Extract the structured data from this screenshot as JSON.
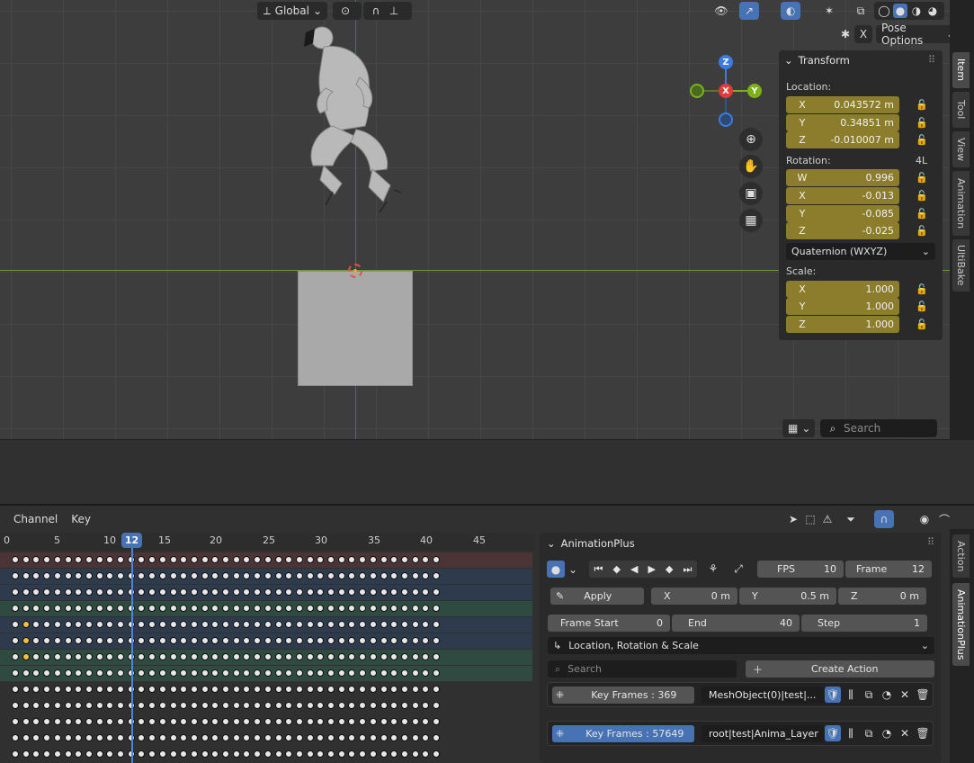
{
  "viewport_header": {
    "orientation_label": "Global",
    "pose_options_label": "Pose Options",
    "x_mirror_label": "X"
  },
  "gizmo": {
    "z": "Z",
    "x": "X",
    "y": "Y"
  },
  "transform_panel": {
    "title": "Transform",
    "location_label": "Location:",
    "location": [
      {
        "axis": "X",
        "value": "0.043572 m"
      },
      {
        "axis": "Y",
        "value": "0.34851 m"
      },
      {
        "axis": "Z",
        "value": "-0.010007 m"
      }
    ],
    "rotation_label": "Rotation:",
    "rotation_mode_badge": "4L",
    "rotation": [
      {
        "axis": "W",
        "value": "0.996"
      },
      {
        "axis": "X",
        "value": "-0.013"
      },
      {
        "axis": "Y",
        "value": "-0.085"
      },
      {
        "axis": "Z",
        "value": "-0.025"
      }
    ],
    "rotation_mode": "Quaternion (WXYZ)",
    "scale_label": "Scale:",
    "scale": [
      {
        "axis": "X",
        "value": "1.000"
      },
      {
        "axis": "Y",
        "value": "1.000"
      },
      {
        "axis": "Z",
        "value": "1.000"
      }
    ]
  },
  "viewport_tabs": [
    "Item",
    "Tool",
    "View",
    "Animation",
    "UltiBake"
  ],
  "viewport_search_placeholder": "Search",
  "dope_sheet": {
    "menus": [
      "Channel",
      "Key"
    ],
    "current_frame": "12",
    "ticks": [
      "0",
      "5",
      "10",
      "15",
      "20",
      "25",
      "30",
      "35",
      "40",
      "45"
    ]
  },
  "animation_plus": {
    "title": "AnimationPlus",
    "fps_label": "FPS",
    "fps_value": "10",
    "frame_label": "Frame",
    "frame_value": "12",
    "apply_label": "Apply",
    "x_label": "X",
    "x_value": "0 m",
    "y_label": "Y",
    "y_value": "0.5 m",
    "z_label": "Z",
    "z_value": "0 m",
    "frame_start_label": "Frame Start",
    "frame_start_value": "0",
    "end_label": "End",
    "end_value": "40",
    "step_label": "Step",
    "step_value": "1",
    "keying_set": "Location, Rotation & Scale",
    "search_placeholder": "Search",
    "create_action_label": "Create Action",
    "keyframe_rows": [
      {
        "label": "Key Frames : 369",
        "name": "MeshObject(0)|test|..."
      },
      {
        "label": "Key Frames : 57649",
        "name": "root|test|Anima_Layer"
      }
    ]
  },
  "bottom_tabs": [
    "Action",
    "AnimationPlus"
  ],
  "colors": {
    "accent": "#4772b3",
    "animated_field": "#8b7d2b",
    "axis_x": "#e03c3c",
    "axis_y": "#7cb11a",
    "axis_z": "#3c7be0"
  }
}
